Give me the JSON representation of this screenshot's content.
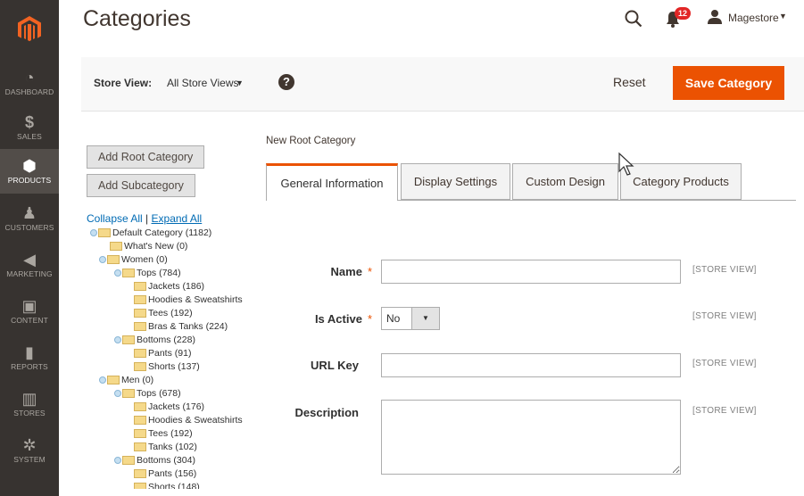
{
  "header": {
    "title": "Categories",
    "notification_count": "12",
    "username": "Magestore"
  },
  "sidebar": {
    "items": [
      {
        "label": "DASHBOARD",
        "icon": "speedometer-icon"
      },
      {
        "label": "SALES",
        "icon": "dollar-icon"
      },
      {
        "label": "PRODUCTS",
        "icon": "cube-icon",
        "active": true
      },
      {
        "label": "CUSTOMERS",
        "icon": "person-icon"
      },
      {
        "label": "MARKETING",
        "icon": "megaphone-icon"
      },
      {
        "label": "CONTENT",
        "icon": "layout-icon"
      },
      {
        "label": "REPORTS",
        "icon": "bar-chart-icon"
      },
      {
        "label": "STORES",
        "icon": "store-icon"
      },
      {
        "label": "SYSTEM",
        "icon": "gear-icon"
      }
    ]
  },
  "toolbar": {
    "store_view_label": "Store View:",
    "store_view_value": "All Store Views",
    "help": "?",
    "reset_label": "Reset",
    "save_label": "Save Category"
  },
  "tree": {
    "add_root_label": "Add Root Category",
    "add_sub_label": "Add Subcategory",
    "collapse_label": "Collapse All",
    "separator": "|",
    "expand_label": "Expand All",
    "nodes": [
      {
        "label": "Default Category (1182)",
        "level": 0,
        "expander": true
      },
      {
        "label": "What's New (0)",
        "level": 1,
        "expander": false
      },
      {
        "label": "Women (0)",
        "level": 1,
        "expander": true
      },
      {
        "label": "Tops (784)",
        "level": 2,
        "expander": true
      },
      {
        "label": "Jackets (186)",
        "level": 3,
        "expander": false
      },
      {
        "label": "Hoodies & Sweatshirts",
        "level": 3,
        "expander": false
      },
      {
        "label": "Tees (192)",
        "level": 3,
        "expander": false
      },
      {
        "label": "Bras & Tanks (224)",
        "level": 3,
        "expander": false
      },
      {
        "label": "Bottoms (228)",
        "level": 2,
        "expander": true
      },
      {
        "label": "Pants (91)",
        "level": 3,
        "expander": false
      },
      {
        "label": "Shorts (137)",
        "level": 3,
        "expander": false
      },
      {
        "label": "Men (0)",
        "level": 1,
        "expander": true
      },
      {
        "label": "Tops (678)",
        "level": 2,
        "expander": true
      },
      {
        "label": "Jackets (176)",
        "level": 3,
        "expander": false
      },
      {
        "label": "Hoodies & Sweatshirts",
        "level": 3,
        "expander": false
      },
      {
        "label": "Tees (192)",
        "level": 3,
        "expander": false
      },
      {
        "label": "Tanks (102)",
        "level": 3,
        "expander": false
      },
      {
        "label": "Bottoms (304)",
        "level": 2,
        "expander": true
      },
      {
        "label": "Pants (156)",
        "level": 3,
        "expander": false
      },
      {
        "label": "Shorts (148)",
        "level": 3,
        "expander": false
      }
    ]
  },
  "main": {
    "section_title": "New Root Category",
    "tabs": [
      {
        "label": "General Information",
        "active": true
      },
      {
        "label": "Display Settings"
      },
      {
        "label": "Custom Design"
      },
      {
        "label": "Category Products"
      }
    ],
    "form": {
      "name_label": "Name",
      "name_value": "",
      "active_label": "Is Active",
      "active_value": "No",
      "url_label": "URL Key",
      "url_value": "",
      "desc_label": "Description",
      "desc_value": "",
      "required_mark": "*",
      "scope": "[STORE VIEW]"
    }
  },
  "colors": {
    "sidebar_bg": "#373330",
    "accent": "#eb5202",
    "link": "#006bb4"
  }
}
